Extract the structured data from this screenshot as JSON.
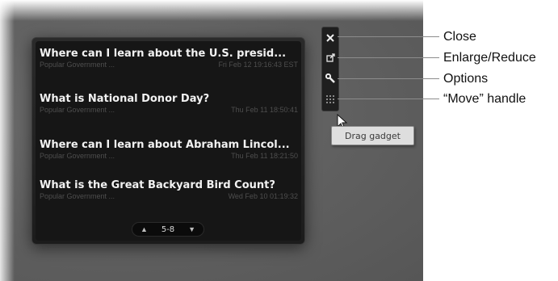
{
  "gadget": {
    "items": [
      {
        "title": "Where can I learn about the U.S. presid...",
        "category": "Popular Government ...",
        "date": "Fri Feb 12 19:16:43 EST"
      },
      {
        "title": "What is National Donor Day?",
        "category": "Popular Government ...",
        "date": "Thu Feb 11 18:50:41"
      },
      {
        "title": "Where can I learn about Abraham Lincol...",
        "category": "Popular Government ...",
        "date": "Thu Feb 11 18:21:50"
      },
      {
        "title": "What is the Great Backyard Bird Count?",
        "category": "Popular Government ...",
        "date": "Wed Feb 10 01:19:32"
      }
    ],
    "pager": {
      "range": "5-8",
      "prev_icon": "triangle-up-icon",
      "next_icon": "triangle-down-icon"
    }
  },
  "toolbar": {
    "buttons": [
      {
        "name": "close",
        "icon": "close-icon"
      },
      {
        "name": "enlarge-reduce",
        "icon": "resize-icon"
      },
      {
        "name": "options",
        "icon": "wrench-icon"
      },
      {
        "name": "move-handle",
        "icon": "grip-icon"
      }
    ]
  },
  "tooltip": {
    "text": "Drag gadget"
  },
  "callouts": {
    "close": "Close",
    "enlarge_reduce": "Enlarge/Reduce",
    "options": "Options",
    "move_handle": "“Move” handle"
  },
  "colors": {
    "gadget_bg": "#1c1c1c",
    "title_text": "#f2f2f2",
    "meta_text": "#4e4e4e",
    "tooltip_bg": "#dedede"
  }
}
